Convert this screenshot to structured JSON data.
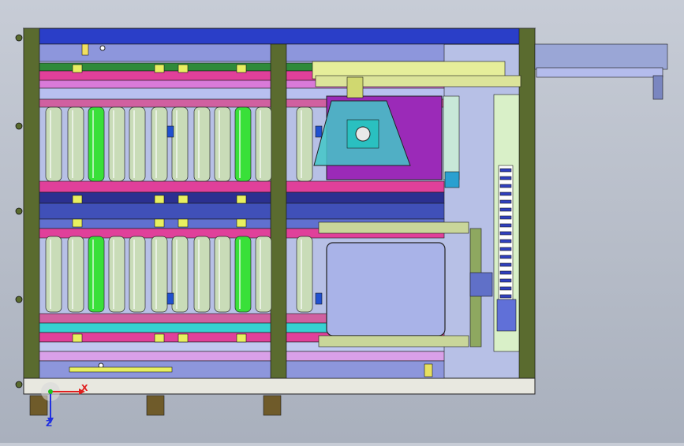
{
  "viewport": {
    "background_top": "#c7ccd6",
    "background_bottom": "#a9b0bd"
  },
  "model": {
    "frame_color": "#5a6b2f",
    "top_panel_color": "#2a3ec8",
    "roller_color": "#c9dcb8",
    "roller_highlight": "#39e039",
    "bracket_magenta": "#e0409a",
    "cyan_part": "#37d1d1",
    "purple_part": "#9b2ab8",
    "panel_lavender": "#a9b3e8",
    "leg_color": "#6f5b2a",
    "gantry_yellow": "#e6ee9a"
  },
  "triad": {
    "x_label": "X",
    "z_label": "Z",
    "x_color": "#e02020",
    "z_color": "#2030e0",
    "y_color": "#20c020"
  }
}
